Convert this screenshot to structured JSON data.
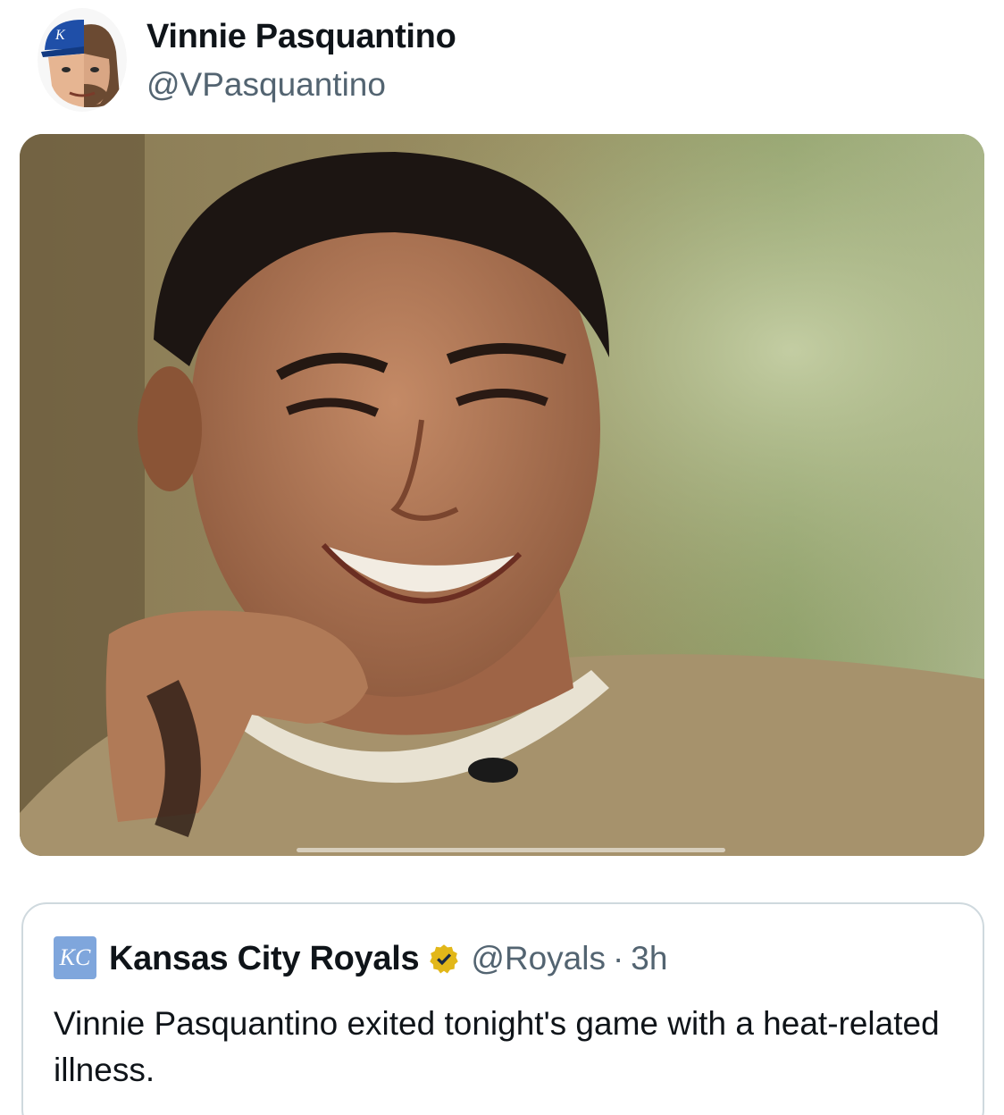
{
  "post": {
    "author_name": "Vinnie Pasquantino",
    "author_handle": "@VPasquantino",
    "avatar_icon": "cartoon-avatar-icon",
    "media_description_icon": "video-thumbnail"
  },
  "quoted_post": {
    "logo_text": "KC",
    "author_name": "Kansas City Royals",
    "verified_icon": "verified-gold-badge-icon",
    "author_handle": "@Royals",
    "separator": "·",
    "time": "3h",
    "text": "Vinnie Pasquantino exited tonight's game with a heat-related illness."
  },
  "colors": {
    "handle_gray": "#536471",
    "border": "#cfd9de",
    "badge_gold": "#e2b719",
    "royals_blue": "#7fa6dc"
  }
}
